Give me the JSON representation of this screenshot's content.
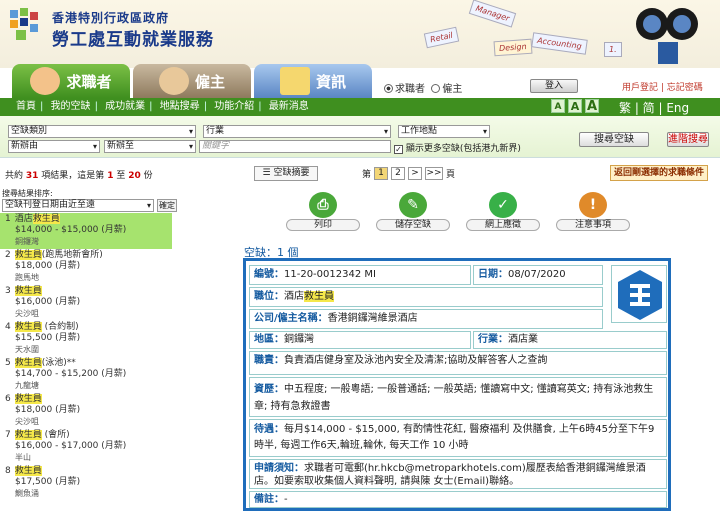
{
  "header": {
    "org_line1": "香港特別行政區政府",
    "org_line2": "勞工處互動就業服務",
    "notes": [
      "Retail",
      "Manager",
      "Design",
      "Accounting",
      "1."
    ]
  },
  "tabs": [
    {
      "label": "求職者"
    },
    {
      "label": "僱主"
    },
    {
      "label": "資訊"
    }
  ],
  "role_radios": {
    "seeker": "求職者",
    "employer": "僱主"
  },
  "login_label": "登入",
  "user_links": "用戶登記 | 忘記密碼",
  "nav": [
    "首頁",
    "我的空缺",
    "成功就業",
    "地點搜尋",
    "功能介紹",
    "最新消息"
  ],
  "font_sizes": [
    "A",
    "A",
    "A"
  ],
  "lang": "繁 | 简 | Eng",
  "search": {
    "vacancy_type": "空缺類別",
    "industry": "行業",
    "location": "工作地點",
    "sort_new": "新辦由",
    "sort_old": "新辦至",
    "keyword_placeholder": "關鍵字",
    "more_checkbox": "顯示更多空缺(包括港九新界)",
    "search_btn": "搜尋空缺",
    "advanced_btn": "進階搜尋"
  },
  "results": {
    "prefix": "共約",
    "total": "31",
    "mid": "項結果，這是第",
    "from": "1",
    "to_word": "至",
    "to": "20",
    "suffix": "份"
  },
  "summary_btn": "空缺摘要",
  "pager": {
    "prefix": "第",
    "pages": [
      "1",
      "2",
      ">",
      ">>"
    ],
    "suffix": "頁"
  },
  "back_btn": "返回剛選擇的求職條件",
  "sort": {
    "label": "搜尋結果排序:",
    "value": "空缺刊登日期由近至遠",
    "confirm": "確定"
  },
  "list": [
    {
      "num": "1",
      "title_pre": "酒店",
      "title_hl": "救生員",
      "title_post": "",
      "salary": "$14,000 - $15,000 (月薪)",
      "loc": "銅鑼灣",
      "selected": true
    },
    {
      "num": "2",
      "title_pre": "",
      "title_hl": "救生員",
      "title_post": "(跑馬地新會所)",
      "salary": "$18,000 (月薪)",
      "loc": "跑馬地",
      "selected": false
    },
    {
      "num": "3",
      "title_pre": "",
      "title_hl": "救生員",
      "title_post": "",
      "salary": "$16,000 (月薪)",
      "loc": "尖沙咀",
      "selected": false
    },
    {
      "num": "4",
      "title_pre": "",
      "title_hl": "救生員",
      "title_post": " (合約制)",
      "salary": "$15,500 (月薪)",
      "loc": "天水圍",
      "selected": false
    },
    {
      "num": "5",
      "title_pre": "",
      "title_hl": "救生員",
      "title_post": "(泳池)**",
      "salary": "$14,700 - $15,200 (月薪)",
      "loc": "九龍塘",
      "selected": false
    },
    {
      "num": "6",
      "title_pre": "",
      "title_hl": "救生員",
      "title_post": "",
      "salary": "$18,000 (月薪)",
      "loc": "尖沙咀",
      "selected": false
    },
    {
      "num": "7",
      "title_pre": "",
      "title_hl": "救生員",
      "title_post": " (會所)",
      "salary": "$16,000 - $17,000 (月薪)",
      "loc": "半山",
      "selected": false
    },
    {
      "num": "8",
      "title_pre": "",
      "title_hl": "救生員",
      "title_post": "",
      "salary": "$17,500 (月薪)",
      "loc": "鰂魚涌",
      "selected": false
    }
  ],
  "actions": [
    {
      "icon": "print-icon",
      "label": "列印"
    },
    {
      "icon": "save-icon",
      "label": "儲存空缺"
    },
    {
      "icon": "check-icon",
      "label": "網上應徵"
    },
    {
      "icon": "info-icon",
      "label": "注意事項"
    }
  ],
  "vacancy_count": "空缺：1 個",
  "detail": {
    "no_label": "編號：",
    "no": "11-20-0012342 MI",
    "date_label": "日期：",
    "date": "08/07/2020",
    "pos_label": "職位：",
    "pos_pre": "酒店",
    "pos_hl": "救生員",
    "company_label": "公司/僱主名稱：",
    "company": "香港銅鑼灣維景酒店",
    "area_label": "地區：",
    "area": "銅鑼灣",
    "industry_label": "行業：",
    "industry": "酒店業",
    "duty_label": "職責：",
    "duty": "負責酒店健身室及泳池內安全及清潔;協助及解答客人之查詢",
    "qual_label": "資歷：",
    "qual": "中五程度; 一般粵語; 一般普通話; 一般英語; 懂讀寫中文; 懂讀寫英文; 持有泳池救生章; 持有急救證書",
    "terms_label": "待遇：",
    "terms": "每月$14,000 - $15,000, 有酌情性花紅, 醫療福利 及供膳食, 上午6時45分至下午9時半, 每週工作6天,輪班,輪休, 每天工作 10 小時",
    "apply_label": "申請須知：",
    "apply": "求職者可電郵(hr.hkcb@metroparkhotels.com)履歷表給香港銅鑼灣維景酒店。如要索取收集個人資料聲明, 請與陳 女士(Email)聯絡。",
    "remark_label": "備註：",
    "remark": "-"
  },
  "colors": {
    "green": "#3f8f1f",
    "blue": "#1f6dbb",
    "highlight": "#f5e84a"
  }
}
